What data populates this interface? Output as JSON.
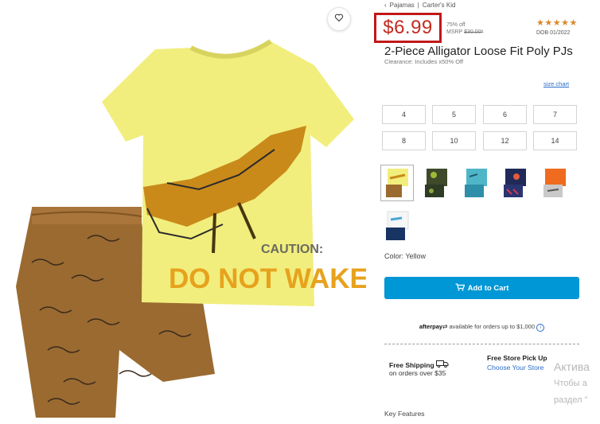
{
  "breadcrumb": {
    "back_icon": "chevron-left-icon",
    "section": "Pajamas",
    "separator": "|",
    "brand": "Carter's Kid"
  },
  "price": {
    "current": "$6.99",
    "percent_off": "75% off",
    "msrp_label": "MSRP",
    "msrp_value": "$30.00*"
  },
  "rating": {
    "stars": "★★★★★",
    "dob": "DOB 01/2022"
  },
  "product": {
    "title": "2-Piece Alligator Loose Fit Poly PJs",
    "clearance": "Clearance: Includes x50% Off",
    "shirt_text_line1": "CAUTION:",
    "shirt_text_line2": "DO NOT WAKE!"
  },
  "sizes": {
    "chart_link": "size chart",
    "options": [
      "4",
      "5",
      "6",
      "7",
      "8",
      "10",
      "12",
      "14"
    ]
  },
  "color": {
    "label": "Color: Yellow"
  },
  "cart": {
    "add_label": "Add to Cart"
  },
  "afterpay": {
    "logo": "afterpay",
    "text": "available for orders up to $1,000"
  },
  "shipping": {
    "title": "Free Shipping",
    "subtitle": "on orders over $35"
  },
  "pickup": {
    "title": "Free Store Pick Up",
    "link": "Choose Your Store"
  },
  "features": {
    "heading": "Key Features"
  },
  "watermark": {
    "line1": "Актива",
    "line2": "Чтобы а",
    "line3": "раздел \""
  },
  "colors": {
    "price_red": "#c32b21",
    "accent_blue": "#0097d6",
    "star_orange": "#d9892a",
    "link_blue": "#2a6cc8"
  }
}
